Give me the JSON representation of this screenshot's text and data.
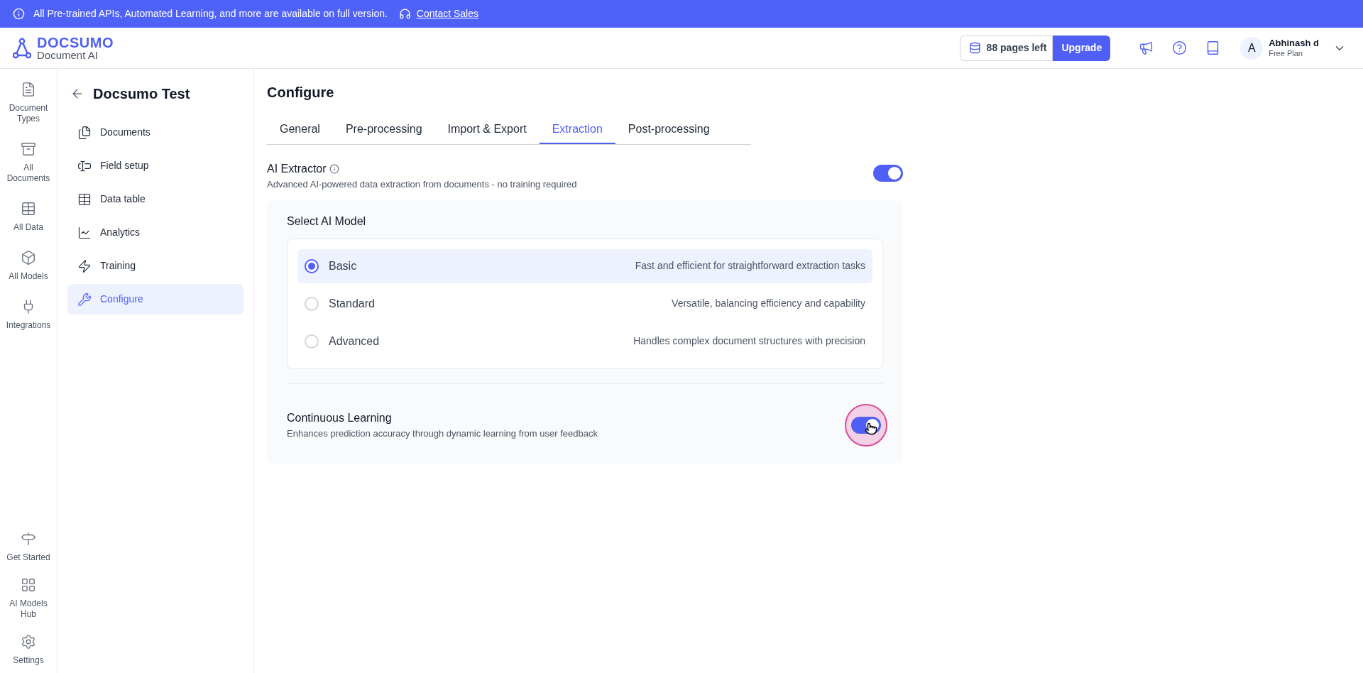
{
  "banner": {
    "message": "All Pre-trained APIs, Automated Learning, and more are available on full version.",
    "link": "Contact Sales"
  },
  "header": {
    "logo_name": "DOCSUMO",
    "logo_tagline": "Document AI",
    "pages_left": "88 pages left",
    "upgrade": "Upgrade",
    "user": {
      "initial": "A",
      "name": "Abhinash d",
      "plan": "Free Plan"
    }
  },
  "rail": {
    "top": [
      {
        "label": "Document Types"
      },
      {
        "label": "All Documents"
      },
      {
        "label": "All Data"
      },
      {
        "label": "All Models"
      },
      {
        "label": "Integrations"
      }
    ],
    "bottom": [
      {
        "label": "Get Started"
      },
      {
        "label": "AI Models Hub"
      },
      {
        "label": "Settings"
      }
    ]
  },
  "sidebar": {
    "title": "Docsumo Test",
    "items": [
      {
        "label": "Documents",
        "selected": false
      },
      {
        "label": "Field setup",
        "selected": false
      },
      {
        "label": "Data table",
        "selected": false
      },
      {
        "label": "Analytics",
        "selected": false
      },
      {
        "label": "Training",
        "selected": false
      },
      {
        "label": "Configure",
        "selected": true
      }
    ]
  },
  "page": {
    "title": "Configure",
    "tabs": [
      {
        "label": "General",
        "selected": false
      },
      {
        "label": "Pre-processing",
        "selected": false
      },
      {
        "label": "Import & Export",
        "selected": false
      },
      {
        "label": "Extraction",
        "selected": true
      },
      {
        "label": "Post-processing",
        "selected": false
      }
    ],
    "ai_extractor": {
      "title": "AI Extractor",
      "description": "Advanced AI-powered data extraction from documents - no training required",
      "on": true
    },
    "model_section": {
      "title": "Select AI Model",
      "options": [
        {
          "label": "Basic",
          "description": "Fast and efficient for straightforward extraction tasks",
          "selected": true
        },
        {
          "label": "Standard",
          "description": "Versatile, balancing efficiency and capability",
          "selected": false
        },
        {
          "label": "Advanced",
          "description": "Handles complex document structures with precision",
          "selected": false
        }
      ]
    },
    "continuous_learning": {
      "title": "Continuous Learning",
      "description": "Enhances prediction accuracy through dynamic learning from user feedback",
      "on": true
    }
  }
}
